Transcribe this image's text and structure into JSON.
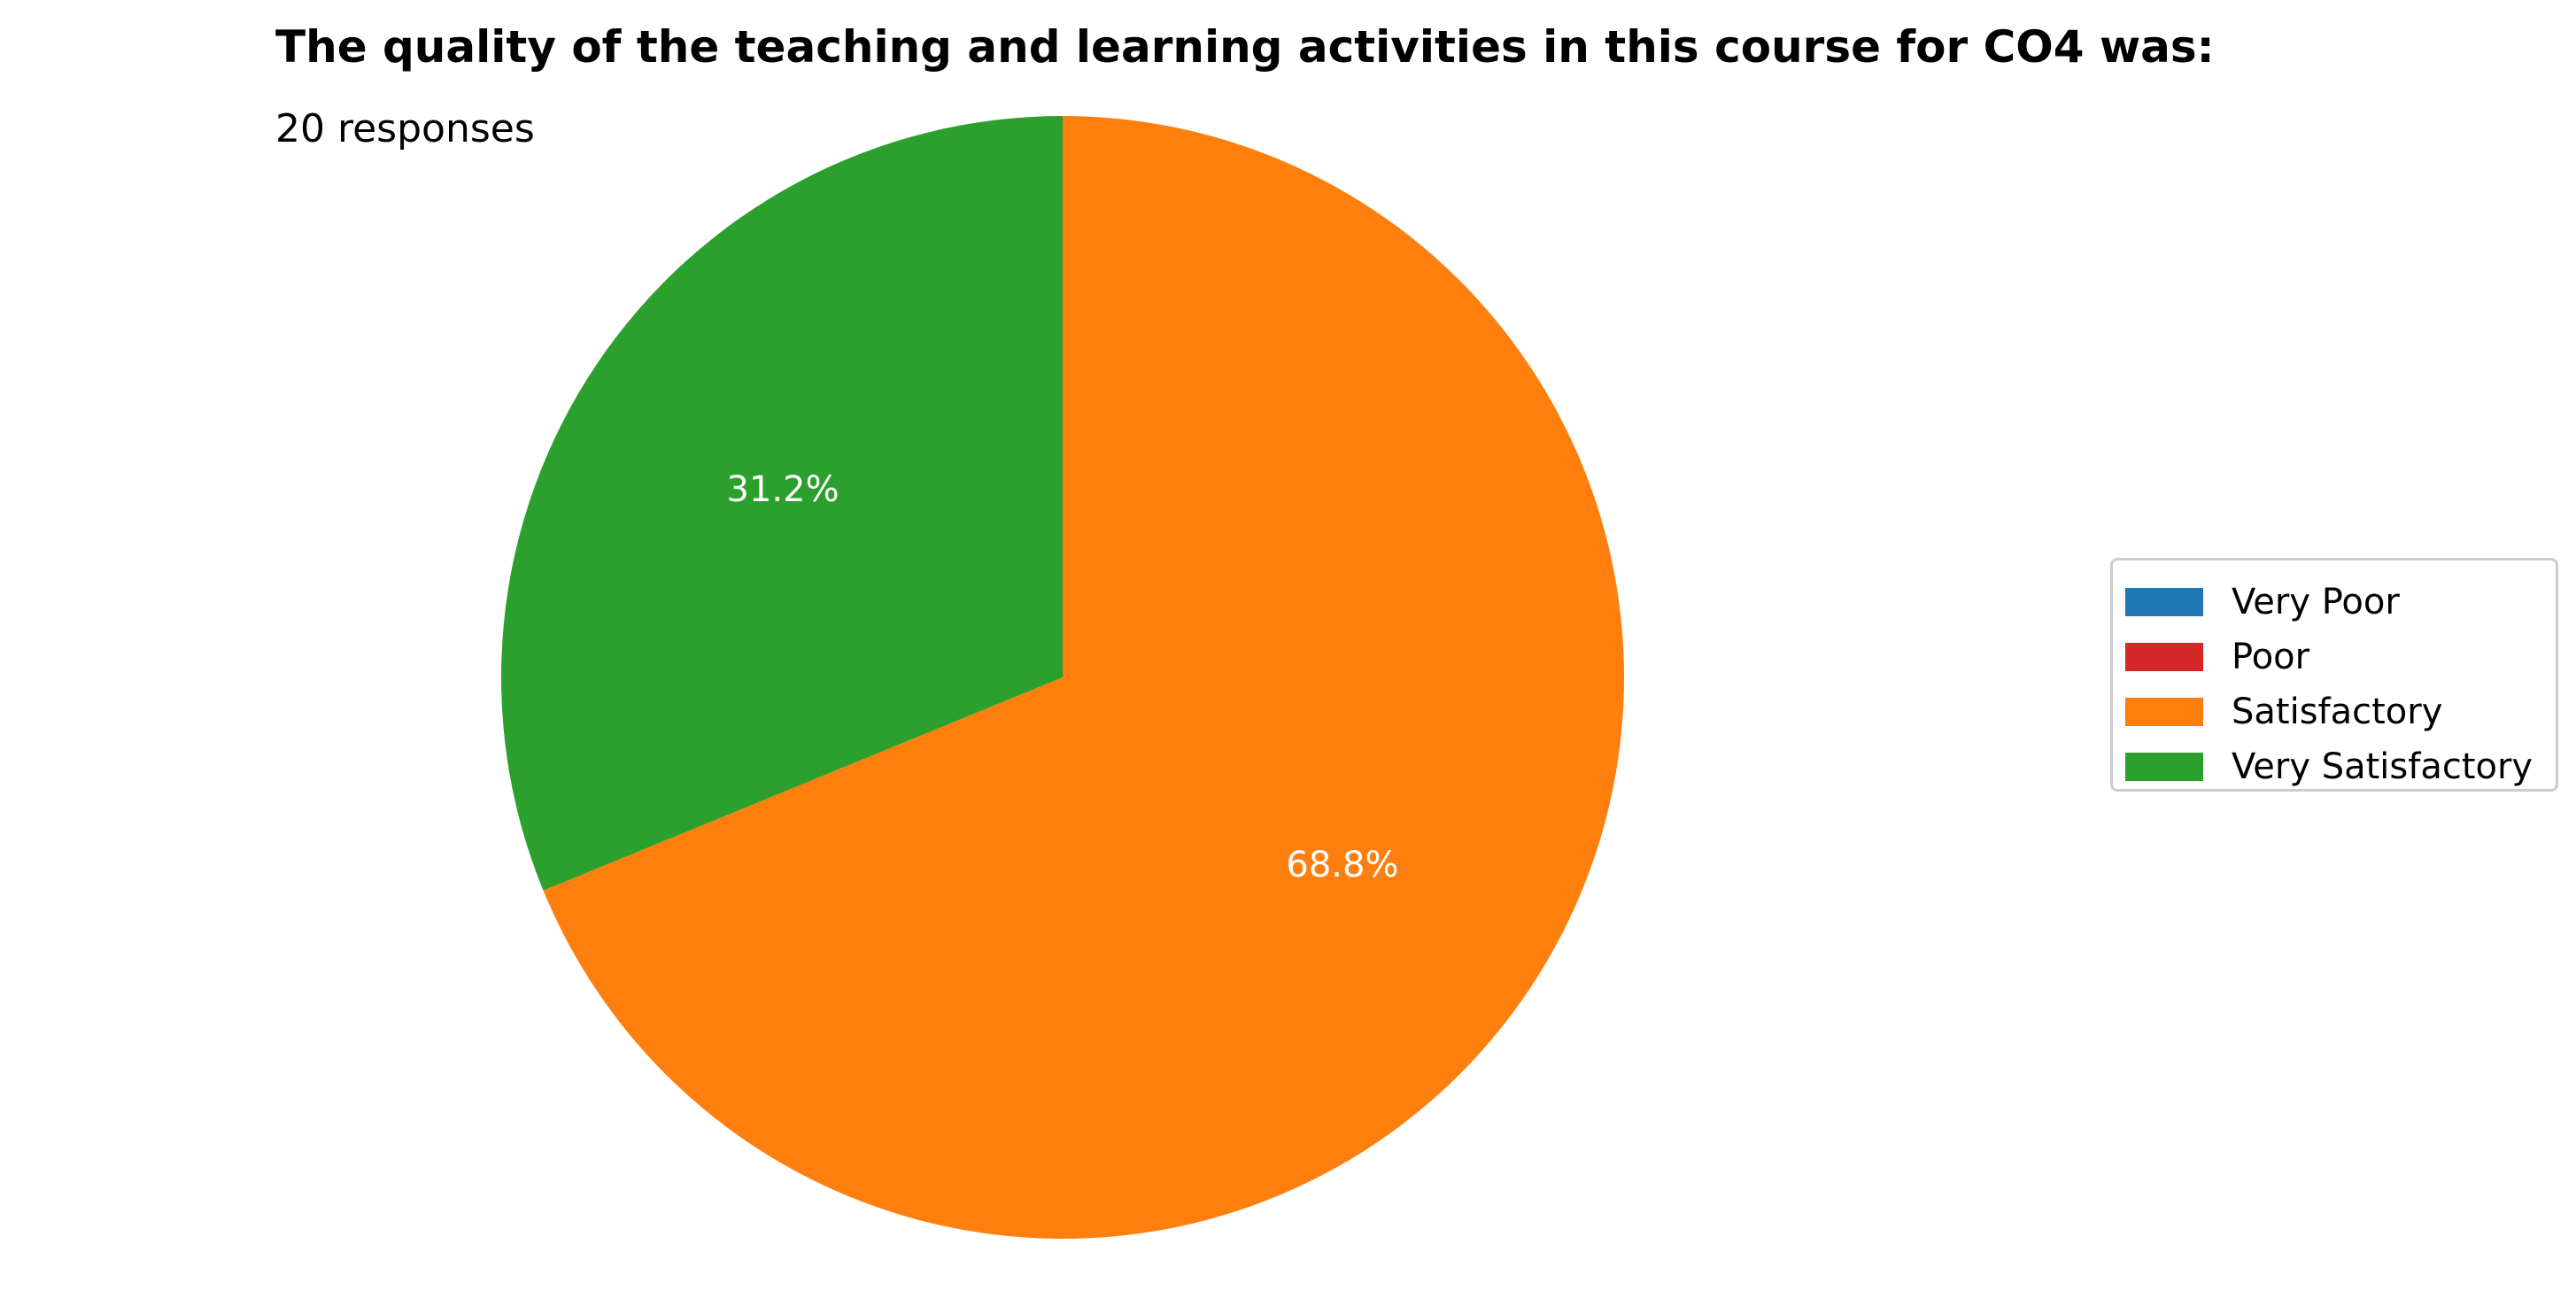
{
  "chart_data": {
    "type": "pie",
    "title": "The quality of the teaching and learning activities in this course for CO4 was:",
    "subtitle": "20 responses",
    "slices": [
      {
        "name": "Very Poor",
        "value": 0.0,
        "color": "#1f77b4"
      },
      {
        "name": "Poor",
        "value": 0.0,
        "color": "#d62728"
      },
      {
        "name": "Satisfactory",
        "value": 68.8,
        "color": "#ff7f0e"
      },
      {
        "name": "Very Satisfactory",
        "value": 31.2,
        "color": "#2ca02c"
      }
    ],
    "start_angle_deg": 90,
    "direction": "clockwise",
    "label_format": "percent_one_decimal",
    "legend_position": "right"
  }
}
